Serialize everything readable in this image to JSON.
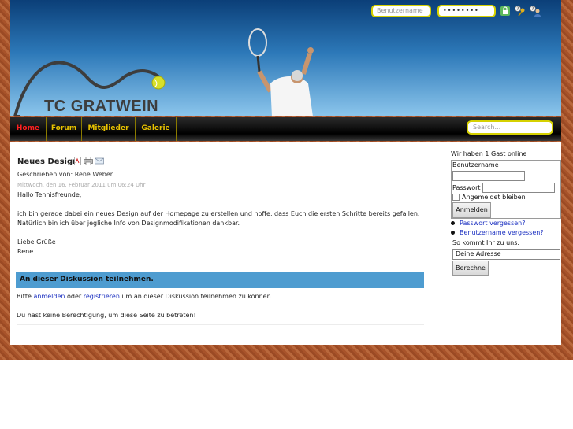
{
  "header": {
    "logo_text": "TC GRATWEIN",
    "login": {
      "username_placeholder": "Benutzername",
      "password_value": "••••••••"
    },
    "icons": [
      "lock-icon",
      "forgot-password-icon",
      "forgot-username-icon"
    ]
  },
  "nav": {
    "items": [
      {
        "label": "Home",
        "active": true
      },
      {
        "label": "Forum"
      },
      {
        "label": "Mitglieder"
      },
      {
        "label": "Galerie"
      }
    ],
    "search_placeholder": "Search..."
  },
  "article": {
    "title": "Neues Design",
    "icons": [
      "pdf-icon",
      "print-icon",
      "email-icon"
    ],
    "author": "Geschrieben von: Rene Weber",
    "date": "Mittwoch, den 16. Februar 2011 um 06:24 Uhr",
    "greeting": "Hallo Tennisfreunde,",
    "line1": "ich bin gerade dabei ein neues Design auf der Homepage zu erstellen und hoffe, dass Euch die ersten Schritte bereits gefallen.",
    "line2": "Natürlich bin ich über jegliche Info von Designmodifikationen dankbar.",
    "closing": "Liebe Grüße",
    "signature": "Rene"
  },
  "discussion": {
    "title": "An dieser Diskussion teilnehmen.",
    "text_before": "Bitte",
    "login_link": "anmelden",
    "text_mid": "oder",
    "register_link": "registrieren",
    "text_after": "um an dieser Diskussion teilnehmen zu können.",
    "no_permission": "Du hast keine Berechtigung, um diese Seite zu betreten!"
  },
  "sidebar": {
    "online": "Wir haben 1 Gast online",
    "username_label": "Benutzername",
    "password_label": "Passwort",
    "remember_label": "Angemeldet bleiben",
    "login_button": "Anmelden",
    "forgot_password": "Passwort vergessen?",
    "forgot_username": "Benutzername vergessen?",
    "route_label": "So kommt Ihr zu uns:",
    "route_value": "Deine Adresse",
    "route_button": "Berechne"
  },
  "colors": {
    "nav_text": "#e8c200",
    "nav_active": "#ff2020",
    "accent_blue": "#4e9cd0",
    "link": "#1a2fc0",
    "clay": "#a8532a"
  }
}
